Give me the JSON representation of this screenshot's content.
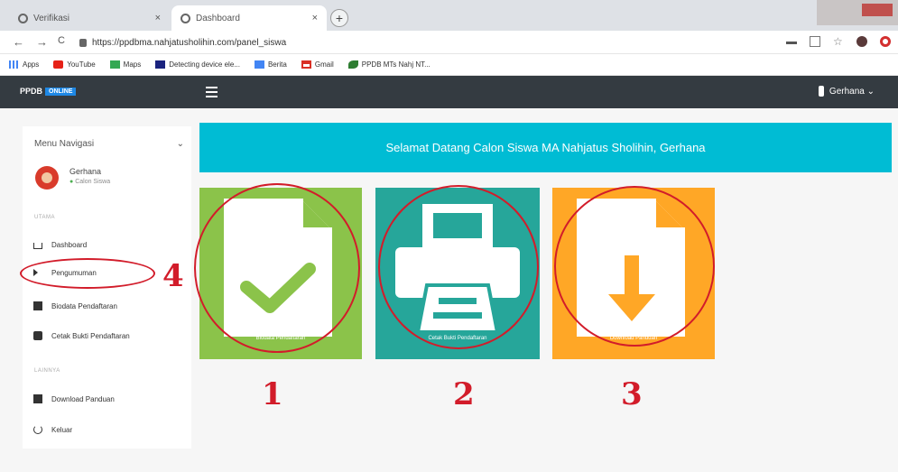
{
  "browser": {
    "tabs": [
      {
        "label": "Verifikasi"
      },
      {
        "label": "Dashboard"
      }
    ],
    "new_tab": "+",
    "url": "https://ppdbma.nahjatusholihin.com/panel_siswa",
    "back": "←",
    "forward": "→",
    "reload": "C",
    "bookmarks": [
      {
        "label": "Apps"
      },
      {
        "label": "YouTube"
      },
      {
        "label": "Maps"
      },
      {
        "label": "Detecting device ele..."
      },
      {
        "label": "Berita"
      },
      {
        "label": "Gmail"
      },
      {
        "label": "PPDB MTs Nahj NT..."
      }
    ]
  },
  "app": {
    "brand": "PPDB",
    "brand_badge": "ONLINE",
    "user_menu": "Gerhana ⌄"
  },
  "sidebar": {
    "title": "Menu Navigasi",
    "chevron": "⌄",
    "user_name": "Gerhana",
    "user_status": "Calon Siswa",
    "section_main": "UTAMA",
    "section_other": "LAINNYA",
    "items": [
      {
        "label": "Dashboard"
      },
      {
        "label": "Pengumuman"
      },
      {
        "label": "Biodata Pendaftaran"
      },
      {
        "label": "Cetak Bukti Pendaftaran"
      },
      {
        "label": "Download Panduan"
      },
      {
        "label": "Keluar"
      }
    ]
  },
  "main": {
    "welcome": "Selamat Datang Calon Siswa MA Nahjatus Sholihin, Gerhana",
    "tiles": [
      {
        "caption": "Biodata Pendaftaran",
        "color": "#8bc34a"
      },
      {
        "caption": "Cetak Bukti Pendaftaran",
        "color": "#26a69a"
      },
      {
        "caption": "Download Panduan",
        "color": "#ffa726"
      }
    ]
  },
  "annotations": {
    "numbers": [
      "1",
      "2",
      "3",
      "4"
    ],
    "color": "#d21c2a"
  }
}
